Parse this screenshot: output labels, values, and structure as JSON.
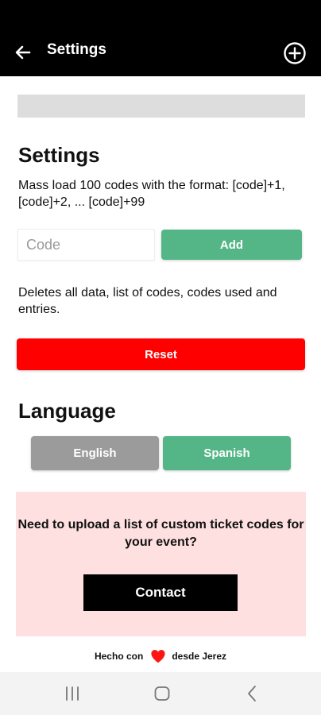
{
  "appbar": {
    "title": "Settings",
    "back_icon": "arrow-left-icon",
    "add_icon": "plus-circle-icon"
  },
  "settings": {
    "heading": "Settings",
    "mass_load_text": "Mass load 100 codes with the format: [code]+1, [code]+2, ... [code]+99",
    "code_placeholder": "Code",
    "code_value": "",
    "add_label": "Add",
    "reset_description": "Deletes all data, list of codes, codes used and entries.",
    "reset_label": "Reset"
  },
  "language": {
    "heading": "Language",
    "options": [
      "English",
      "Spanish"
    ],
    "selected": "Spanish"
  },
  "promo": {
    "text": "Need to upload a list of custom ticket codes for your event?",
    "contact_label": "Contact"
  },
  "footer": {
    "made_with": "Hecho con",
    "from": "desde Jerez",
    "heart_icon": "heart-icon"
  },
  "navbar": {
    "items": [
      "recent-apps-icon",
      "home-icon",
      "back-icon"
    ]
  },
  "colors": {
    "appbar_bg": "#000000",
    "accent_green": "#54b687",
    "reset_red": "#ff0000",
    "inactive_gray": "#9b9b9b",
    "promo_bg": "#fee0e0",
    "banner_gray": "#dddddd"
  }
}
